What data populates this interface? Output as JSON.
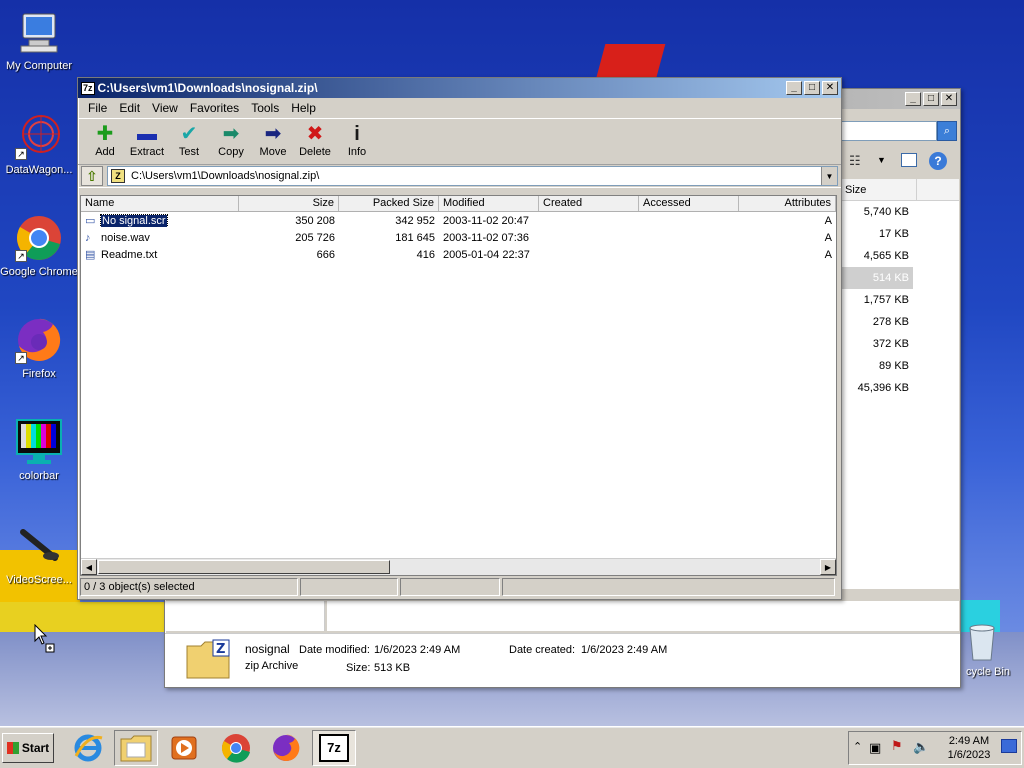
{
  "desktop": {
    "icons": [
      {
        "label": "My Computer",
        "icon": "computer-icon"
      },
      {
        "label": "DataWagon...",
        "icon": "datawagon-icon"
      },
      {
        "label": "Google Chrome",
        "icon": "chrome-icon"
      },
      {
        "label": "Firefox",
        "icon": "firefox-icon"
      },
      {
        "label": "colorbar",
        "icon": "colorbar-icon"
      },
      {
        "label": "VideoScree...",
        "icon": "videoscreen-icon"
      }
    ],
    "recycle_bin_label": "cycle Bin"
  },
  "explorer": {
    "sizes_header": "Size",
    "sizes": [
      "5,740 KB",
      "17 KB",
      "4,565 KB",
      "514 KB",
      "1,757 KB",
      "278 KB",
      "372 KB",
      "89 KB",
      "45,396 KB"
    ],
    "details": {
      "name": "nosignal",
      "type": "zip Archive",
      "modified_label": "Date modified:",
      "modified_value": "1/6/2023 2:49 AM",
      "created_label": "Date created:",
      "created_value": "1/6/2023 2:49 AM",
      "size_label": "Size:",
      "size_value": "513 KB"
    }
  },
  "sevenzip": {
    "title": "C:\\Users\\vm1\\Downloads\\nosignal.zip\\",
    "app_badge": "7z",
    "menu": [
      "File",
      "Edit",
      "View",
      "Favorites",
      "Tools",
      "Help"
    ],
    "toolbar": [
      {
        "label": "Add",
        "icon": "add-icon",
        "glyph": "✚",
        "color": "#1c9c1c"
      },
      {
        "label": "Extract",
        "icon": "extract-icon",
        "glyph": "▬",
        "color": "#1a2fb0"
      },
      {
        "label": "Test",
        "icon": "test-icon",
        "glyph": "✔",
        "color": "#1aa7a7"
      },
      {
        "label": "Copy",
        "icon": "copy-icon",
        "glyph": "➡",
        "color": "#1a8a6a"
      },
      {
        "label": "Move",
        "icon": "move-icon",
        "glyph": "➡",
        "color": "#1a2680"
      },
      {
        "label": "Delete",
        "icon": "delete-icon",
        "glyph": "✖",
        "color": "#d01818"
      },
      {
        "label": "Info",
        "icon": "info-icon",
        "glyph": "i",
        "color": "#1a1a1a"
      }
    ],
    "address": "C:\\Users\\vm1\\Downloads\\nosignal.zip\\",
    "columns": [
      "Name",
      "Size",
      "Packed Size",
      "Modified",
      "Created",
      "Accessed",
      "Attributes"
    ],
    "files": [
      {
        "name": "No signal.scr",
        "size": "350 208",
        "packed": "342 952",
        "modified": "2003-11-02 20:47",
        "created": "",
        "accessed": "",
        "attributes": "A",
        "icon": "screensaver-icon",
        "selected": true
      },
      {
        "name": "noise.wav",
        "size": "205 726",
        "packed": "181 645",
        "modified": "2003-11-02 07:36",
        "created": "",
        "accessed": "",
        "attributes": "A",
        "icon": "audio-file-icon",
        "selected": false
      },
      {
        "name": "Readme.txt",
        "size": "666",
        "packed": "416",
        "modified": "2005-01-04 22:37",
        "created": "",
        "accessed": "",
        "attributes": "A",
        "icon": "text-file-icon",
        "selected": false
      }
    ],
    "status": "0 / 3 object(s) selected"
  },
  "taskbar": {
    "start_label": "Start",
    "apps": [
      "ie-icon",
      "explorer-icon",
      "media-player-icon",
      "chrome-icon",
      "firefox-icon",
      "sevenzip-icon"
    ],
    "time": "2:49 AM",
    "date": "1/6/2023"
  }
}
